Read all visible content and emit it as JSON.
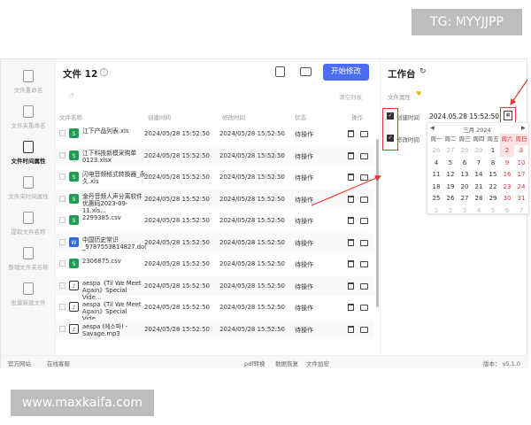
{
  "watermarks": {
    "top": "TG: MYYJJPP",
    "bottom": "www.maxkaifa.com"
  },
  "sidebar": {
    "items": [
      {
        "label": "文件重命名",
        "active": false
      },
      {
        "label": "文件夹重命名",
        "active": false
      },
      {
        "label": "文件时间属性",
        "active": true
      },
      {
        "label": "文件夹时间属性",
        "active": false
      },
      {
        "label": "提取文件名称",
        "active": false
      },
      {
        "label": "整理文件夹名称",
        "active": false
      },
      {
        "label": "批量新建文件",
        "active": false
      }
    ]
  },
  "panel": {
    "title": "文件 12",
    "help_glyph": "?",
    "start_button": "开始修改",
    "clear_list": "清空列表",
    "restore_glyph": "↺",
    "columns": [
      "文件名称",
      "创建时间",
      "修改时间",
      "状态",
      "操作"
    ],
    "rows": [
      {
        "name": "江下产品列表.xls",
        "icon": "S",
        "color": "#1f9d55",
        "created": "2024/05/28 15:52:50",
        "modified": "2024/05/28 15:52:50",
        "status": "待操作"
      },
      {
        "name": "江下科技新模采购单0123.xlsx",
        "icon": "S",
        "color": "#1f9d55",
        "created": "2024/05/28 15:52:50",
        "modified": "2024/05/28 15:52:50",
        "status": "待操作"
      },
      {
        "name": "闪电音频格式转换器_永久.xls",
        "icon": "S",
        "color": "#1f9d55",
        "created": "2024/05/28 15:52:50",
        "modified": "2024/05/28 15:52:50",
        "status": "待操作"
      },
      {
        "name": "金丹音频人声分离软件优惠码2023-09-11.xls...",
        "icon": "S",
        "color": "#1f9d55",
        "created": "2024/05/28 15:52:50",
        "modified": "2024/05/28 15:52:50",
        "status": "待操作"
      },
      {
        "name": "2299385.csv",
        "icon": "S",
        "color": "#1f9d55",
        "created": "2024/05/28 15:52:50",
        "modified": "2024/05/28 15:52:50",
        "status": "待操作"
      },
      {
        "name": "中国历史常识_9787553814827.docx",
        "icon": "W",
        "color": "#2b6fd6",
        "created": "2024/05/28 15:52:50",
        "modified": "2024/05/28 15:52:50",
        "status": "待操作"
      },
      {
        "name": "2306875.csv",
        "icon": "S",
        "color": "#1f9d55",
        "created": "2024/05/28 15:52:50",
        "modified": "2024/05/28 15:52:50",
        "status": "待操作"
      },
      {
        "name": "aespa《Til We Meet Again》Special Vide...",
        "icon": "♪",
        "color": "#333333",
        "created": "2024/05/28 15:52:50",
        "modified": "2024/05/28 15:52:50",
        "status": "待操作"
      },
      {
        "name": "aespa《Til We Meet Again》Special Vide...",
        "icon": "♪",
        "color": "#333333",
        "created": "2024/05/28 15:52:50",
        "modified": "2024/05/28 15:52:50",
        "status": "待操作"
      },
      {
        "name": "aespa (에스파) - Savage.mp3",
        "icon": "♪",
        "color": "#333333",
        "created": "2024/05/28 15:52:50",
        "modified": "2024/05/28 15:52:50",
        "status": "待操作"
      }
    ]
  },
  "workbench": {
    "title": "工作台",
    "refresh_glyph": "↻",
    "attr_label": "文件属性",
    "options": [
      {
        "label": "创建时间",
        "checked": true
      },
      {
        "label": "修改时间",
        "checked": true
      }
    ],
    "datetime_value": "2024.05.28 15:52:50",
    "calendar": {
      "month_label": "三月  2024",
      "prev_glyph": "◀",
      "next_glyph": "▶",
      "weekdays": [
        "周一",
        "周二",
        "周三",
        "周四",
        "周五",
        "周六",
        "周日"
      ],
      "weeks": [
        [
          "26",
          "27",
          "28",
          "29",
          "1",
          "2",
          "3"
        ],
        [
          "4",
          "5",
          "6",
          "7",
          "8",
          "9",
          "10"
        ],
        [
          "11",
          "12",
          "13",
          "14",
          "15",
          "16",
          "17"
        ],
        [
          "18",
          "19",
          "20",
          "21",
          "22",
          "23",
          "24"
        ],
        [
          "25",
          "26",
          "27",
          "28",
          "29",
          "30",
          "31"
        ],
        [
          "1",
          "2",
          "3",
          "4",
          "5",
          "6",
          "7"
        ]
      ],
      "weekend_color": "#e53935"
    }
  },
  "statusbar": {
    "official": "官方网站",
    "service": "在线客服",
    "pdf": "pdf转换",
    "recovery": "数据恢复",
    "encrypt": "文件加密",
    "version": "版本： v5.1.0"
  },
  "colors": {
    "accent": "#4a6cf7",
    "highlight": "#e53935"
  }
}
